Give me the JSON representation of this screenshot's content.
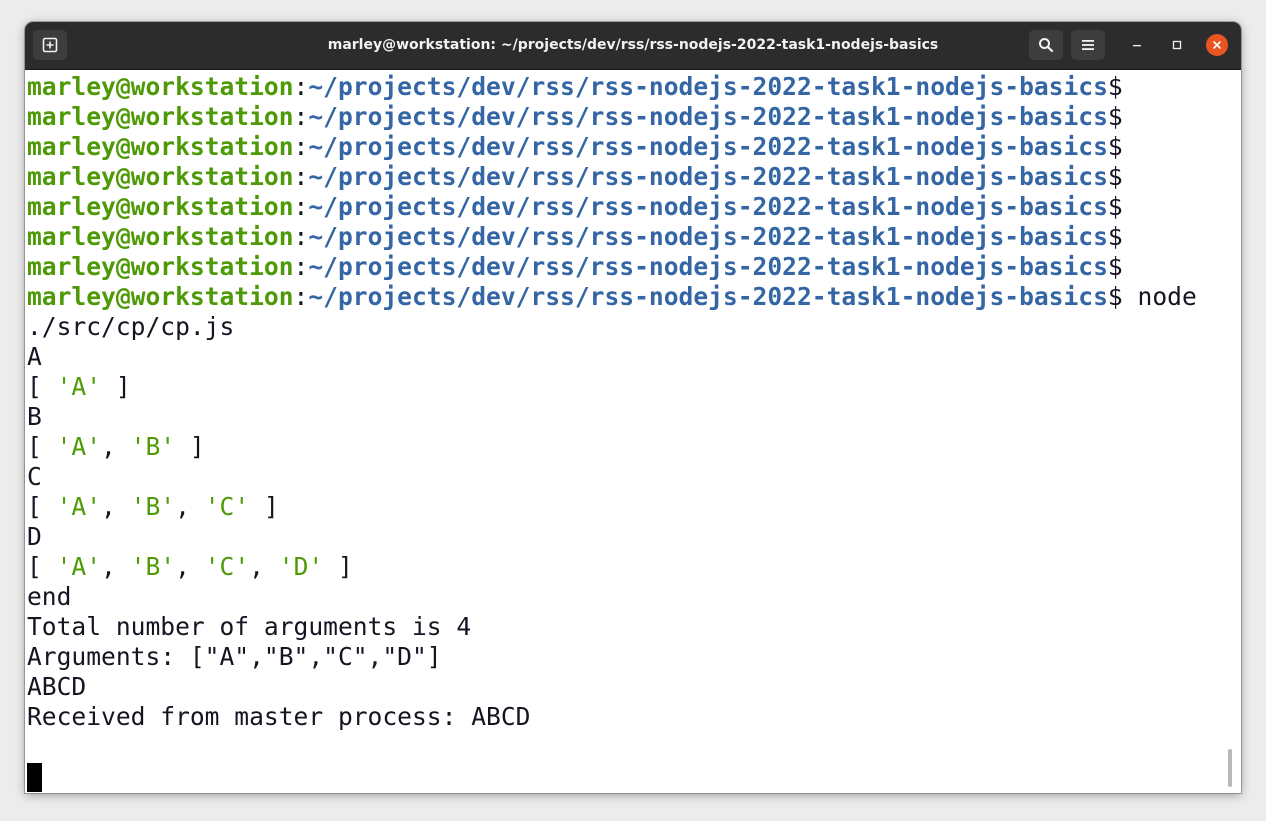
{
  "window": {
    "title": "marley@workstation: ~/projects/dev/rss/rss-nodejs-2022-task1-nodejs-basics"
  },
  "icons": {
    "new_tab": "new-tab-icon",
    "search": "search-icon",
    "menu": "hamburger-menu-icon",
    "minimize": "minimize-icon",
    "maximize": "maximize-icon",
    "close": "close-icon"
  },
  "colors": {
    "titlebar_bg": "#2c2c2c",
    "terminal_bg": "#ffffff",
    "prompt_user": "#4e9a06",
    "prompt_path": "#3465a4",
    "string_literal": "#4e9a06",
    "close_button": "#e95420"
  },
  "prompt": {
    "user_host": "marley@workstation",
    "separator": ":",
    "path": "~/projects/dev/rss/rss-nodejs-2022-task1-nodejs-basics",
    "symbol": "$"
  },
  "terminal": {
    "command": " node",
    "command_cont": "./src/cp/cp.js",
    "out_A": "A",
    "arr1": [
      "[ ",
      "'A'",
      " ]"
    ],
    "out_B": "B",
    "arr2": [
      "[ ",
      "'A'",
      ", ",
      "'B'",
      " ]"
    ],
    "out_C": "C",
    "arr3": [
      "[ ",
      "'A'",
      ", ",
      "'B'",
      ", ",
      "'C'",
      " ]"
    ],
    "out_D": "D",
    "arr4": [
      "[ ",
      "'A'",
      ", ",
      "'B'",
      ", ",
      "'C'",
      ", ",
      "'D'",
      " ]"
    ],
    "out_end": "end",
    "out_total": "Total number of arguments is 4",
    "out_args": "Arguments: [\"A\",\"B\",\"C\",\"D\"]",
    "out_abcd": "ABCD",
    "out_received": "Received from master process: ABCD"
  }
}
